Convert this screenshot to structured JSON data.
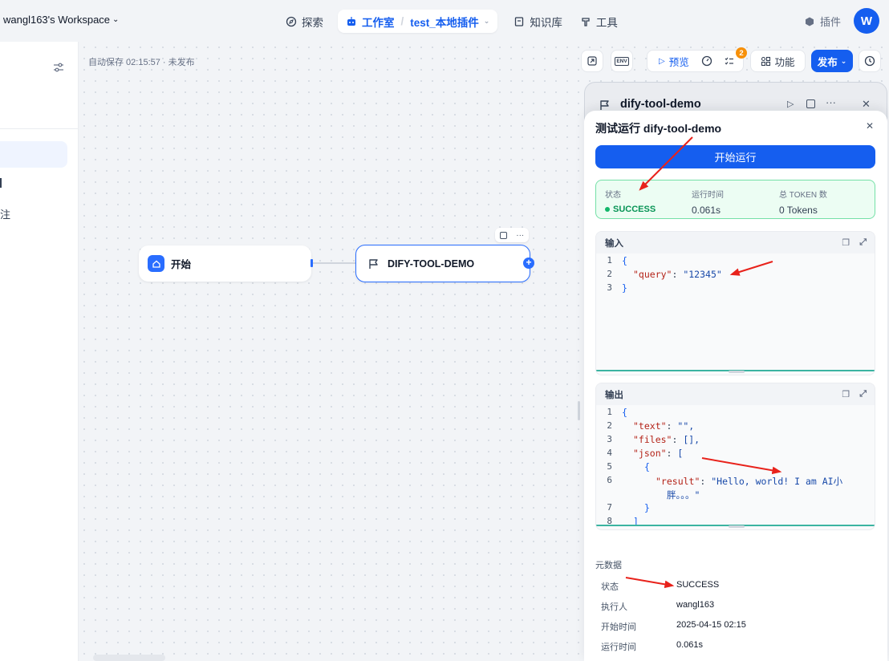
{
  "topbar": {
    "workspace": "wangl163's Workspace",
    "nav_explore": "探索",
    "nav_studio": "工作室",
    "nav_app": "test_本地插件",
    "nav_knowledge": "知识库",
    "nav_tools": "工具",
    "plugins": "插件",
    "avatar_initial": "W"
  },
  "left_panel": {
    "item_fragment": "注"
  },
  "canvas": {
    "autosave": "自动保存 02:15:57 · 未发布",
    "node_start": "开始",
    "node_tool": "DIFY-TOOL-DEMO"
  },
  "toolbar": {
    "env": "ENV",
    "preview": "预览",
    "checklist_badge": "2",
    "features": "功能",
    "publish": "发布"
  },
  "panel_back": {
    "title": "dify-tool-demo"
  },
  "run_panel": {
    "title": "测试运行 dify-tool-demo",
    "run_button": "开始运行",
    "status_label": "状态",
    "status_value": "SUCCESS",
    "time_label": "运行时间",
    "time_value": "0.061s",
    "token_label": "总 TOKEN 数",
    "token_value": "0 Tokens",
    "input_title": "输入",
    "input_lines": [
      {
        "n": "1",
        "t": "{"
      },
      {
        "n": "2",
        "k": "\"query\"",
        "v": "\"12345\""
      },
      {
        "n": "3",
        "t": "}"
      }
    ],
    "output_title": "输出",
    "output_lines": [
      {
        "n": "1",
        "t": "{"
      },
      {
        "n": "2",
        "k": "\"text\"",
        "v": "\"\","
      },
      {
        "n": "3",
        "k": "\"files\"",
        "v": "[],"
      },
      {
        "n": "4",
        "k": "\"json\"",
        "v": "["
      },
      {
        "n": "5",
        "t": "{"
      },
      {
        "n": "6",
        "k": "\"result\"",
        "v": "\"Hello, world! I am AI小"
      },
      {
        "n": "",
        "t": "胖。。。\""
      },
      {
        "n": "7",
        "t": "}"
      },
      {
        "n": "8",
        "t": "]"
      }
    ],
    "metadata_title": "元数据",
    "meta_status_label": "状态",
    "meta_status_value": "SUCCESS",
    "meta_executor_label": "执行人",
    "meta_executor_value": "wangl163",
    "meta_start_label": "开始时间",
    "meta_start_value": "2025-04-15 02:15",
    "meta_time_label": "运行时间",
    "meta_time_value": "0.061s"
  },
  "colors": {
    "accent": "#155eef",
    "success": "#12b76a",
    "annotation_arrow": "#e8221b"
  }
}
